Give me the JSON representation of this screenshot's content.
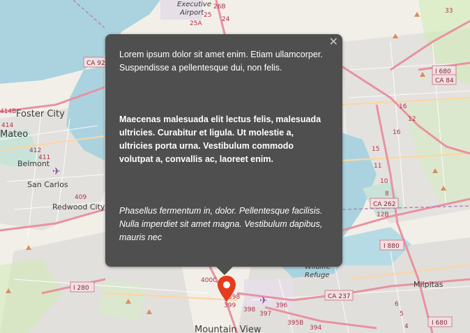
{
  "popup": {
    "close_symbol": "✕",
    "paragraph1": "Lorem ipsum dolor sit amet enim. Etiam ullamcorper. Suspendisse a pellentesque dui, non felis.",
    "paragraph2": "Maecenas malesuada elit lectus felis, malesuada ultricies. Curabitur et ligula. Ut molestie a, ultricies porta urna. Vestibulum commodo volutpat a, convallis ac, laoreet enim.",
    "paragraph3": "Phasellus fermentum in, dolor. Pellentesque facilisis. Nulla imperdiet sit amet magna. Vestibulum dapibus, mauris nec"
  },
  "map": {
    "places": {
      "executive_airport": "Executive",
      "airport": "Airport",
      "foster_city": "Foster City",
      "mateo": "Mateo",
      "belmont": "Belmont",
      "san_carlos": "San Carlos",
      "redwood_city": "Redwood City",
      "mountain_view": "Mountain View",
      "milpitas": "Milpitas",
      "wildlife": "Wildlife",
      "refuge": "Refuge"
    },
    "shields": {
      "ca92": "CA 92",
      "i680": "I 680",
      "ca84": "CA 84",
      "ca262": "CA 262",
      "i880": "I 880",
      "i280": "I 280",
      "ca237": "CA 237",
      "i680b": "I 680"
    },
    "exits": {
      "e26b": "26B",
      "e25": "25",
      "e25a": "25A",
      "e24": "24",
      "e33": "33",
      "e412": "412",
      "e414b": "414B",
      "e414": "414",
      "e411": "411",
      "e409": "409",
      "e16": "16",
      "e15": "15",
      "e12": "12",
      "e16b": "16",
      "e11": "11",
      "e10": "10",
      "e8": "8",
      "e128": "12B",
      "e400c": "400C",
      "e398": "398",
      "e399": "399",
      "e397": "397",
      "e396": "396",
      "e395b": "395B",
      "e394": "394",
      "e6": "6",
      "e5": "5",
      "e4": "4",
      "e398b": "398"
    }
  },
  "colors": {
    "water": "#aad3df",
    "land": "#f2efe9",
    "urban": "#e0dfdf",
    "green": "#cdebb0",
    "motorway": "#e892a2",
    "primary": "#fcd6a4",
    "popup_bg": "#4f4f4f",
    "marker": "#e33d1d"
  },
  "icons": {
    "close": "close-icon",
    "marker": "map-pin-icon"
  }
}
